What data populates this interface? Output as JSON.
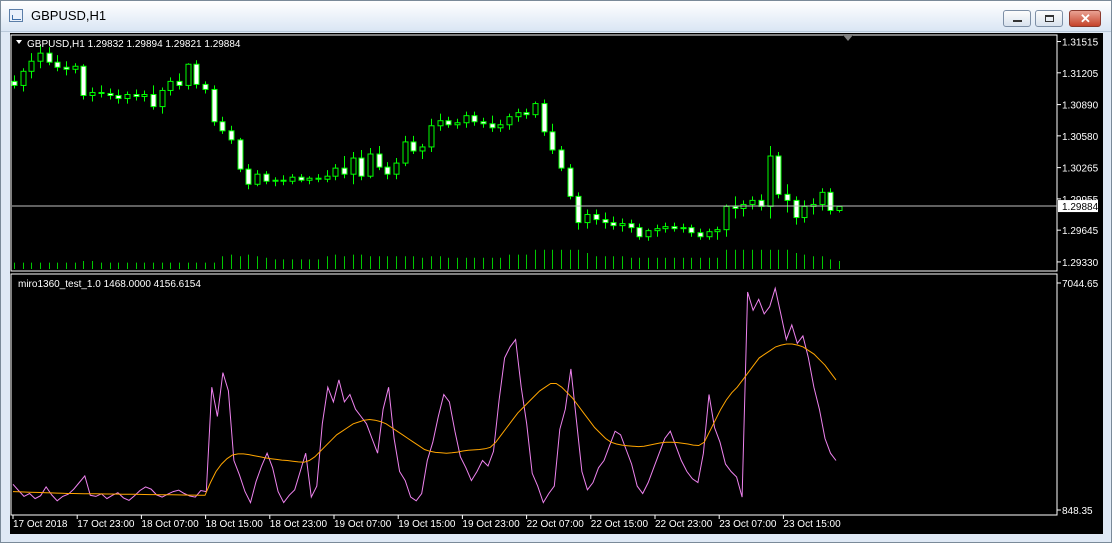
{
  "window": {
    "title": "GBPUSD,H1",
    "app_icon": "chart-window-icon",
    "buttons": [
      "minimize-icon",
      "maximize-icon",
      "close-icon"
    ]
  },
  "colors": {
    "background": "#000000",
    "candle": "#00ff00",
    "volume": "#00c800",
    "price_line": "#c0c0c0",
    "indicator_line": "#ee82ee",
    "indicator_ma": "#ffa500",
    "axis_text": "#ffffff"
  },
  "chart_data": [
    {
      "type": "candlestick",
      "symbol_label": "GBPUSD,H1  1.29832 1.29894 1.29821 1.29884",
      "current_price": "1.29884",
      "current_price_value": 1.29884,
      "ylim": [
        1.2925,
        1.3157
      ],
      "y_ticks": [
        {
          "label": "1.31515",
          "value": 1.31515
        },
        {
          "label": "1.31205",
          "value": 1.31205
        },
        {
          "label": "1.30890",
          "value": 1.3089
        },
        {
          "label": "1.30580",
          "value": 1.3058
        },
        {
          "label": "1.30265",
          "value": 1.30265
        },
        {
          "label": "1.29955",
          "value": 1.29955
        },
        {
          "label": "1.29645",
          "value": 1.29645
        },
        {
          "label": "1.29330",
          "value": 1.2933
        }
      ],
      "candles": [
        [
          1.3112,
          1.3118,
          1.3105,
          1.3108
        ],
        [
          1.3108,
          1.3125,
          1.3102,
          1.3122
        ],
        [
          1.3122,
          1.314,
          1.3115,
          1.3132
        ],
        [
          1.3132,
          1.3148,
          1.3125,
          1.314
        ],
        [
          1.314,
          1.3146,
          1.3128,
          1.3131
        ],
        [
          1.3131,
          1.3138,
          1.3122,
          1.3126
        ],
        [
          1.3126,
          1.3132,
          1.3118,
          1.3124
        ],
        [
          1.3124,
          1.313,
          1.312,
          1.3127
        ],
        [
          1.3127,
          1.3129,
          1.3094,
          1.3098
        ],
        [
          1.3098,
          1.3106,
          1.3092,
          1.3101
        ],
        [
          1.3101,
          1.3108,
          1.3096,
          1.31
        ],
        [
          1.31,
          1.3105,
          1.3094,
          1.3098
        ],
        [
          1.3098,
          1.3104,
          1.309,
          1.3095
        ],
        [
          1.3095,
          1.3102,
          1.309,
          1.3099
        ],
        [
          1.3099,
          1.3104,
          1.3093,
          1.3097
        ],
        [
          1.3097,
          1.3103,
          1.3092,
          1.3099
        ],
        [
          1.3099,
          1.3108,
          1.3084,
          1.3087
        ],
        [
          1.3087,
          1.3106,
          1.308,
          1.3103
        ],
        [
          1.3103,
          1.3116,
          1.3098,
          1.3112
        ],
        [
          1.3112,
          1.312,
          1.3104,
          1.3108
        ],
        [
          1.3108,
          1.313,
          1.3104,
          1.3129
        ],
        [
          1.3129,
          1.3133,
          1.3105,
          1.3109
        ],
        [
          1.3109,
          1.3112,
          1.31,
          1.3104
        ],
        [
          1.3104,
          1.3108,
          1.3068,
          1.3072
        ],
        [
          1.3072,
          1.3077,
          1.306,
          1.3063
        ],
        [
          1.3063,
          1.3068,
          1.305,
          1.3054
        ],
        [
          1.3054,
          1.3056,
          1.3022,
          1.3025
        ],
        [
          1.3025,
          1.303,
          1.3005,
          1.301
        ],
        [
          1.301,
          1.3024,
          1.3008,
          1.302
        ],
        [
          1.302,
          1.3023,
          1.301,
          1.3013
        ],
        [
          1.3013,
          1.3017,
          1.3008,
          1.3014
        ],
        [
          1.3014,
          1.3019,
          1.3009,
          1.3013
        ],
        [
          1.3013,
          1.302,
          1.301,
          1.3017
        ],
        [
          1.3017,
          1.302,
          1.3012,
          1.3014
        ],
        [
          1.3014,
          1.3018,
          1.301,
          1.3016
        ],
        [
          1.3016,
          1.302,
          1.3012,
          1.3015
        ],
        [
          1.3015,
          1.3024,
          1.3012,
          1.3018
        ],
        [
          1.3018,
          1.303,
          1.3014,
          1.3026
        ],
        [
          1.3026,
          1.3038,
          1.3016,
          1.302
        ],
        [
          1.302,
          1.3042,
          1.301,
          1.3036
        ],
        [
          1.3036,
          1.3044,
          1.3014,
          1.3018
        ],
        [
          1.3018,
          1.3046,
          1.3016,
          1.304
        ],
        [
          1.304,
          1.3048,
          1.3024,
          1.3027
        ],
        [
          1.3027,
          1.3032,
          1.3015,
          1.302
        ],
        [
          1.302,
          1.3036,
          1.3015,
          1.3031
        ],
        [
          1.3031,
          1.3058,
          1.3028,
          1.3052
        ],
        [
          1.3052,
          1.3058,
          1.304,
          1.3043
        ],
        [
          1.3043,
          1.305,
          1.3035,
          1.3047
        ],
        [
          1.3047,
          1.3075,
          1.3042,
          1.3068
        ],
        [
          1.3068,
          1.308,
          1.3063,
          1.3073
        ],
        [
          1.3073,
          1.3077,
          1.3066,
          1.3069
        ],
        [
          1.3069,
          1.3075,
          1.3065,
          1.3071
        ],
        [
          1.3071,
          1.3082,
          1.3066,
          1.3078
        ],
        [
          1.3078,
          1.3082,
          1.3068,
          1.3072
        ],
        [
          1.3072,
          1.3076,
          1.3066,
          1.307
        ],
        [
          1.307,
          1.3078,
          1.3062,
          1.3066
        ],
        [
          1.3066,
          1.3074,
          1.3062,
          1.3069
        ],
        [
          1.3069,
          1.308,
          1.3064,
          1.3077
        ],
        [
          1.3077,
          1.3085,
          1.3072,
          1.3081
        ],
        [
          1.3081,
          1.3085,
          1.3075,
          1.3079
        ],
        [
          1.3079,
          1.3092,
          1.3076,
          1.309
        ],
        [
          1.309,
          1.3094,
          1.3058,
          1.3062
        ],
        [
          1.3062,
          1.307,
          1.304,
          1.3044
        ],
        [
          1.3044,
          1.3048,
          1.3023,
          1.3026
        ],
        [
          1.3026,
          1.303,
          1.2995,
          1.2998
        ],
        [
          1.2998,
          1.3002,
          1.2965,
          1.2972
        ],
        [
          1.2972,
          1.2985,
          1.2966,
          1.298
        ],
        [
          1.298,
          1.2985,
          1.297,
          1.2975
        ],
        [
          1.2975,
          1.2982,
          1.2966,
          1.2972
        ],
        [
          1.2972,
          1.2978,
          1.2965,
          1.2969
        ],
        [
          1.2969,
          1.2976,
          1.2963,
          1.2971
        ],
        [
          1.2971,
          1.2975,
          1.2962,
          1.2967
        ],
        [
          1.2967,
          1.2971,
          1.2955,
          1.2958
        ],
        [
          1.2958,
          1.2966,
          1.2954,
          1.2964
        ],
        [
          1.2964,
          1.297,
          1.2958,
          1.2966
        ],
        [
          1.2966,
          1.2972,
          1.2962,
          1.2968
        ],
        [
          1.2968,
          1.2972,
          1.2963,
          1.2966
        ],
        [
          1.2966,
          1.2971,
          1.2962,
          1.2967
        ],
        [
          1.2967,
          1.297,
          1.2958,
          1.2962
        ],
        [
          1.2962,
          1.2966,
          1.2955,
          1.2958
        ],
        [
          1.2958,
          1.2966,
          1.2955,
          1.2963
        ],
        [
          1.2963,
          1.2968,
          1.2955,
          1.2965
        ],
        [
          1.2965,
          1.299,
          1.2958,
          1.2988
        ],
        [
          1.2988,
          1.2998,
          1.2976,
          1.2986
        ],
        [
          1.2986,
          1.2994,
          1.2978,
          1.299
        ],
        [
          1.299,
          1.2998,
          1.2985,
          1.2994
        ],
        [
          1.2994,
          1.3,
          1.2984,
          1.2988
        ],
        [
          1.2988,
          1.3048,
          1.2976,
          1.3038
        ],
        [
          1.3038,
          1.3042,
          1.2996,
          1.3
        ],
        [
          1.3,
          1.301,
          1.2982,
          1.2994
        ],
        [
          1.2994,
          1.2998,
          1.297,
          1.2977
        ],
        [
          1.2977,
          1.2994,
          1.2972,
          1.2988
        ],
        [
          1.2988,
          1.2996,
          1.298,
          1.299
        ],
        [
          1.299,
          1.3006,
          1.2984,
          1.3002
        ],
        [
          1.3002,
          1.3006,
          1.298,
          1.2984
        ],
        [
          1.2984,
          1.2989,
          1.2982,
          1.2988
        ]
      ],
      "volumes": [
        4,
        4,
        4,
        4,
        4,
        4,
        4,
        4,
        5,
        5,
        4,
        4,
        4,
        4,
        4,
        4,
        4,
        4,
        4,
        4,
        4,
        4,
        4,
        4,
        8,
        9,
        8,
        9,
        8,
        7,
        6,
        6,
        6,
        6,
        6,
        6,
        8,
        9,
        8,
        9,
        9,
        8,
        8,
        8,
        8,
        8,
        8,
        7,
        8,
        8,
        7,
        7,
        7,
        7,
        7,
        7,
        7,
        9,
        9,
        9,
        12,
        12,
        12,
        12,
        12,
        12,
        10,
        8,
        8,
        8,
        8,
        7,
        7,
        7,
        7,
        7,
        7,
        7,
        7,
        7,
        7,
        7,
        12,
        12,
        12,
        12,
        12,
        12,
        12,
        12,
        10,
        9,
        8,
        8,
        6,
        5
      ]
    },
    {
      "type": "line",
      "name": "miro1360_test_1.0",
      "label": "miro1360_test_1.0 1468.0000 4156.6154",
      "ylim": [
        848.35,
        7044.65
      ],
      "y_ticks": [
        {
          "label": "7044.65",
          "value": 7044.65
        },
        {
          "label": "848.35",
          "value": 848.35
        }
      ],
      "series": [
        {
          "values": [
            1550,
            1380,
            1220,
            1300,
            1160,
            1240,
            1480,
            1260,
            1100,
            1220,
            1280,
            1420,
            1600,
            1780,
            1250,
            1220,
            1290,
            1160,
            1250,
            1320,
            1180,
            1110,
            1240,
            1380,
            1480,
            1420,
            1260,
            1200,
            1280,
            1350,
            1390,
            1300,
            1230,
            1200,
            1380,
            1350,
            4200,
            3400,
            4600,
            4100,
            2200,
            1800,
            1350,
            1050,
            1620,
            2050,
            2400,
            2000,
            1350,
            1050,
            1250,
            1400,
            1900,
            2400,
            1200,
            1500,
            3200,
            4200,
            3800,
            4400,
            3800,
            4000,
            3600,
            3400,
            3200,
            2800,
            2400,
            3600,
            4200,
            2800,
            1900,
            1650,
            1200,
            1100,
            1300,
            2200,
            2700,
            3400,
            4000,
            3800,
            3000,
            2300,
            2000,
            1650,
            1900,
            2200,
            2050,
            2450,
            3850,
            5000,
            5300,
            5500,
            4200,
            3200,
            1850,
            1500,
            1050,
            1300,
            1500,
            3050,
            3600,
            4700,
            3300,
            1900,
            1400,
            1600,
            2000,
            2200,
            2600,
            3000,
            2900,
            2500,
            2100,
            1500,
            1300,
            1600,
            2000,
            2400,
            2800,
            3000,
            2600,
            2200,
            1900,
            1700,
            1600,
            2400,
            4000,
            3100,
            2700,
            2100,
            1900,
            1750,
            1200,
            6800,
            6300,
            6600,
            6200,
            6400,
            6900,
            6200,
            5500,
            5900,
            5400,
            5600,
            5000,
            4200,
            3600,
            2800,
            2400,
            2200
          ]
        },
        {
          "values": [
            1350,
            1345,
            1340,
            1335,
            1330,
            1325,
            1320,
            1315,
            1310,
            1305,
            1300,
            1298,
            1296,
            1294,
            1292,
            1290,
            1288,
            1286,
            1284,
            1282,
            1280,
            1278,
            1276,
            1274,
            1272,
            1270,
            1268,
            1266,
            1264,
            1262,
            1260,
            1258,
            1256,
            1254,
            1252,
            1250,
            1600,
            1900,
            2100,
            2250,
            2350,
            2380,
            2380,
            2360,
            2330,
            2300,
            2270,
            2250,
            2230,
            2210,
            2200,
            2180,
            2160,
            2150,
            2200,
            2300,
            2450,
            2600,
            2750,
            2900,
            3000,
            3100,
            3200,
            3250,
            3300,
            3320,
            3300,
            3260,
            3200,
            3100,
            3000,
            2900,
            2800,
            2700,
            2600,
            2500,
            2450,
            2420,
            2410,
            2400,
            2410,
            2430,
            2460,
            2480,
            2490,
            2500,
            2520,
            2560,
            2700,
            2900,
            3100,
            3300,
            3500,
            3650,
            3800,
            3950,
            4100,
            4200,
            4300,
            4300,
            4200,
            4050,
            3900,
            3700,
            3500,
            3300,
            3100,
            2950,
            2800,
            2700,
            2650,
            2620,
            2600,
            2590,
            2580,
            2590,
            2620,
            2650,
            2680,
            2700,
            2700,
            2690,
            2670,
            2650,
            2620,
            2610,
            2700,
            3000,
            3300,
            3600,
            3850,
            4050,
            4200,
            4400,
            4600,
            4800,
            5000,
            5100,
            5200,
            5300,
            5350,
            5380,
            5380,
            5350,
            5300,
            5200,
            5100,
            4950,
            4800,
            4600,
            4400
          ]
        }
      ]
    }
  ],
  "x_ticks": [
    "17 Oct 2018",
    "17 Oct 23:00",
    "18 Oct 07:00",
    "18 Oct 15:00",
    "18 Oct 23:00",
    "19 Oct 07:00",
    "19 Oct 15:00",
    "19 Oct 23:00",
    "22 Oct 07:00",
    "22 Oct 15:00",
    "22 Oct 23:00",
    "23 Oct 07:00",
    "23 Oct 15:00"
  ]
}
